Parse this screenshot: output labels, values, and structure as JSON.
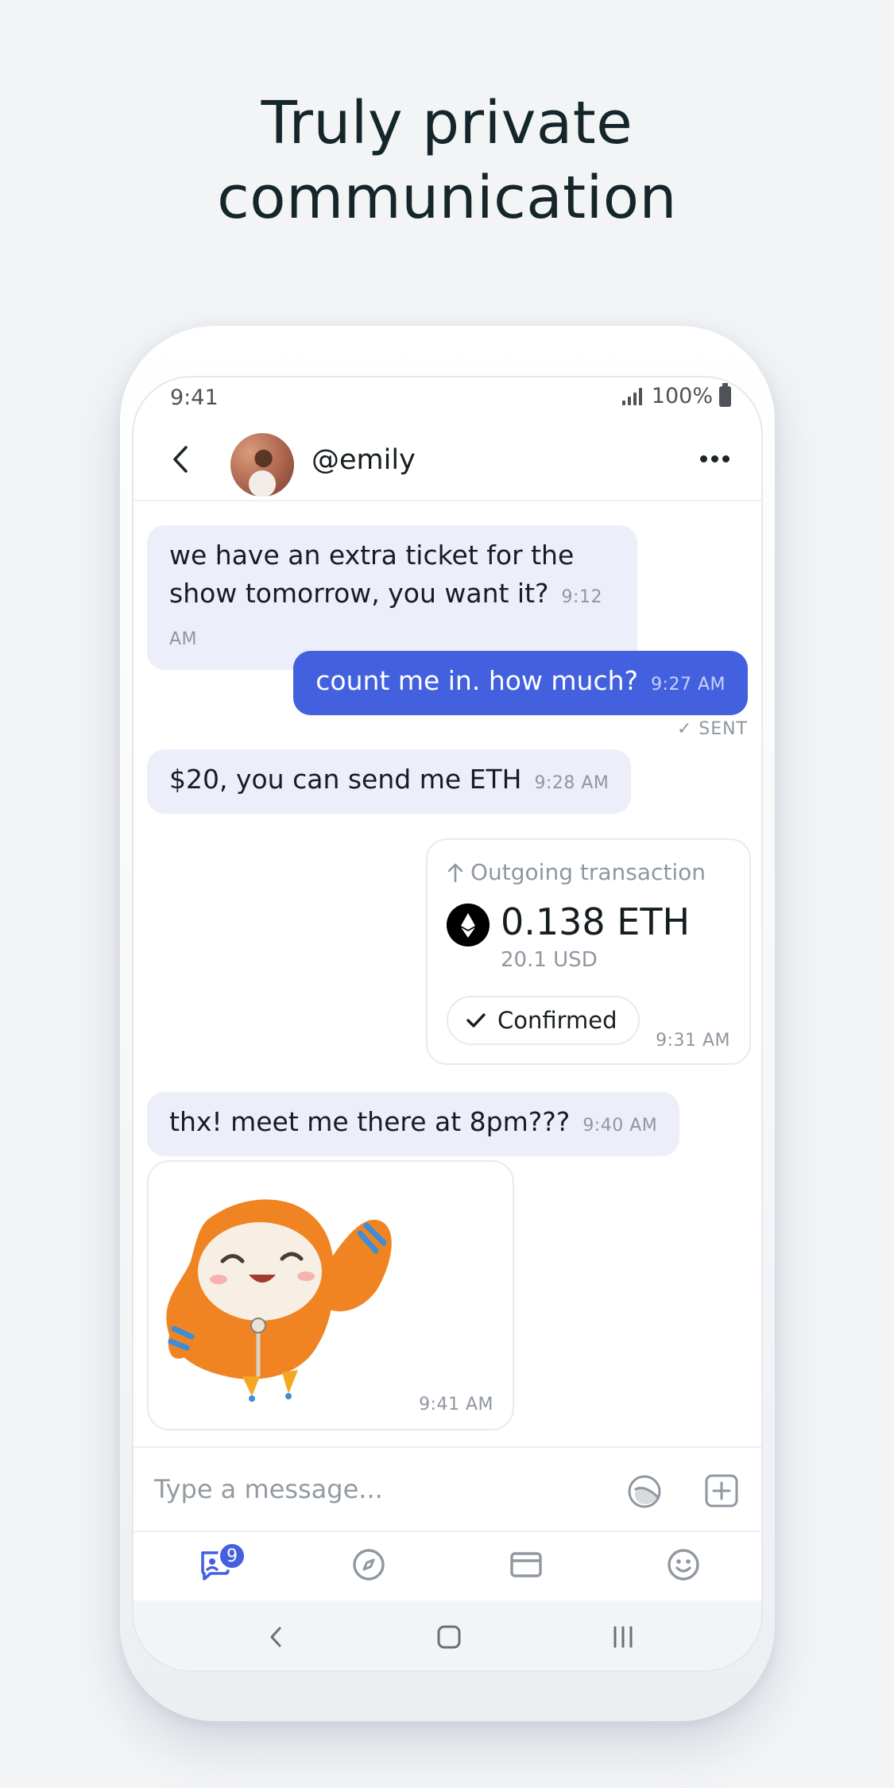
{
  "headline": {
    "line1": "Truly private",
    "line2": "communication"
  },
  "status_bar": {
    "time": "9:41",
    "battery": "100%"
  },
  "chat_header": {
    "username": "@emily"
  },
  "messages": [
    {
      "direction": "incoming",
      "line1": "we have an extra ticket for the",
      "line2": "show tomorrow, you want it?",
      "time": "9:12 AM"
    },
    {
      "direction": "outgoing",
      "text": "count me in. how much?",
      "time": "9:27 AM",
      "status": "✓ SENT"
    },
    {
      "direction": "incoming",
      "text": "$20, you can send me ETH",
      "time": "9:28 AM"
    },
    {
      "direction": "incoming",
      "text": "thx! meet me there at 8pm???",
      "time": "9:40 AM"
    }
  ],
  "transaction": {
    "label": "Outgoing transaction",
    "amount": "0.138 ETH",
    "fiat": "20.1 USD",
    "status": "Confirmed",
    "time": "9:31 AM"
  },
  "sticker": {
    "time": "9:41 AM"
  },
  "composer": {
    "placeholder": "Type a message..."
  },
  "tabbar": {
    "chats_badge": "9"
  },
  "colors": {
    "accent": "#4360df",
    "incoming_bubble": "#eceef9",
    "sticker_orange": "#f08423"
  }
}
